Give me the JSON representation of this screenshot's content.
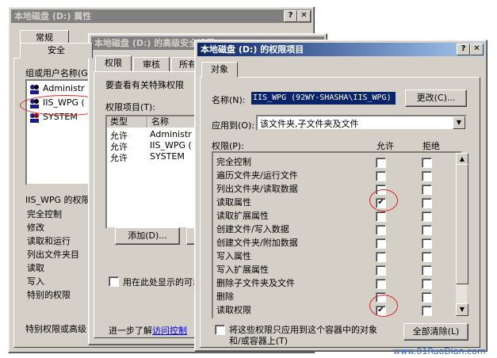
{
  "dialog1": {
    "title": "本地磁盘 (D:) 属性",
    "tabs": [
      "常规",
      "安全"
    ],
    "group_label": "组或用户名称(G):",
    "users": [
      "Administr",
      "IIS_WPG (",
      "SYSTEM"
    ],
    "perm_label": "IIS_WPG 的权限",
    "perms": [
      "完全控制",
      "修改",
      "读取和运行",
      "列出文件夹目",
      "读取",
      "写入",
      "特别的权限"
    ],
    "footer": "特别权限或高级"
  },
  "dialog2": {
    "title": "本地磁盘 (D:) 的高级安全设置",
    "tabs": [
      "权限",
      "审核",
      "所有"
    ],
    "info": "要查看有关特殊权限",
    "entries_label": "权限项目(T):",
    "columns": [
      "类型",
      "名称"
    ],
    "rows": [
      {
        "type": "允许",
        "name": "Administr"
      },
      {
        "type": "允许",
        "name": "IIS_WPG ("
      },
      {
        "type": "允许",
        "name": "SYSTEM"
      }
    ],
    "add_button": "添加(D)...",
    "apply_check": "用在此处显示的可以",
    "learn_prefix": "进一步了解",
    "learn_link": "访问控制"
  },
  "dialog3": {
    "title": "本地磁盘 (D:) 的权限项目",
    "tab": "对象",
    "name_label": "名称(N):",
    "name_value": "IIS_WPG (92WY-SHASHA\\IIS_WPG)",
    "change_button": "更改(C)...",
    "apply_label": "应用到(O):",
    "apply_value": "该文件夹,子文件夹及文件",
    "perm_label": "权限(P):",
    "col_allow": "允许",
    "col_deny": "拒绝",
    "permissions": [
      {
        "name": "完全控制",
        "allow": false,
        "deny": false
      },
      {
        "name": "遍历文件夹/运行文件",
        "allow": false,
        "deny": false
      },
      {
        "name": "列出文件夹/读取数据",
        "allow": false,
        "deny": false
      },
      {
        "name": "读取属性",
        "allow": true,
        "deny": false
      },
      {
        "name": "读取扩展属性",
        "allow": false,
        "deny": false
      },
      {
        "name": "创建文件/写入数据",
        "allow": false,
        "deny": false
      },
      {
        "name": "创建文件夹/附加数据",
        "allow": false,
        "deny": false
      },
      {
        "name": "写入属性",
        "allow": false,
        "deny": false
      },
      {
        "name": "写入扩展属性",
        "allow": false,
        "deny": false
      },
      {
        "name": "删除子文件夹及文件",
        "allow": false,
        "deny": false
      },
      {
        "name": "删除",
        "allow": false,
        "deny": false
      },
      {
        "name": "读取权限",
        "allow": true,
        "deny": false
      }
    ],
    "apply_only_line1": "将这些权限只应用到这个容器中的对象",
    "apply_only_line2": "和/或容器上(T)",
    "clear_button": "全部清除(L)"
  },
  "watermark": "www.01RuoDian.com",
  "accent_red": "#e0201a",
  "title_active": "#0a246a"
}
